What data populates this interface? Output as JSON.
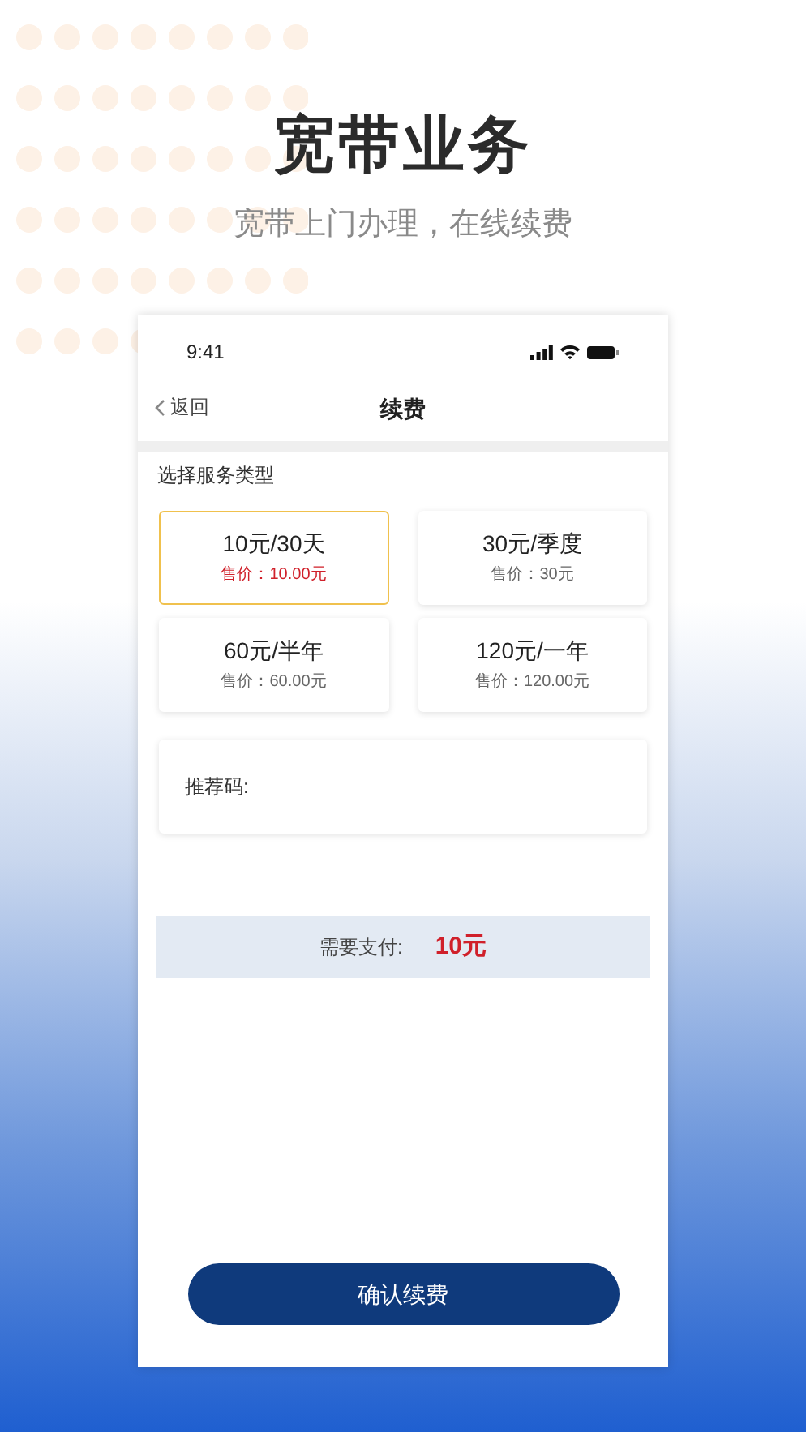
{
  "headline": "宽带业务",
  "subtitle": "宽带上门办理，在线续费",
  "phone": {
    "status_bar": {
      "time": "9:41"
    },
    "nav": {
      "back": "返回",
      "title": "续费"
    },
    "section_label": "选择服务类型",
    "plans": [
      {
        "name": "10元/30天",
        "price": "售价：10.00元",
        "selected": true
      },
      {
        "name": "30元/季度",
        "price": "售价：30元",
        "selected": false
      },
      {
        "name": "60元/半年",
        "price": "售价：60.00元",
        "selected": false
      },
      {
        "name": "120元/一年",
        "price": "售价：120.00元",
        "selected": false
      }
    ],
    "referral": {
      "label": "推荐码:"
    },
    "payment": {
      "label": "需要支付:",
      "amount": "10元"
    },
    "confirm_button": "确认续费"
  }
}
